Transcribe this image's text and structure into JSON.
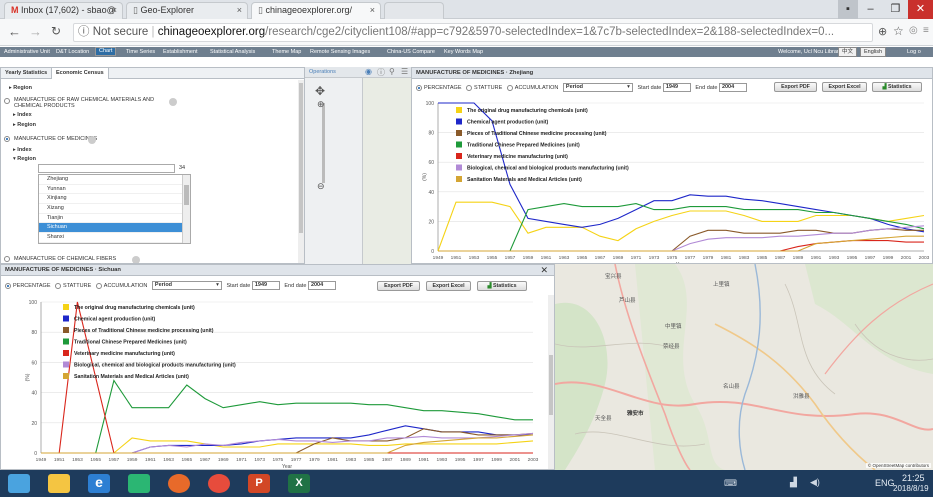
{
  "browser": {
    "tabs": [
      {
        "title": "Inbox (17,602) - sbao@",
        "icon": "gmail-icon"
      },
      {
        "title": "Geo-Explorer",
        "icon": "page-icon"
      },
      {
        "title": "chinageoexplorer.org/",
        "icon": "page-icon"
      }
    ],
    "security": "Not secure",
    "url_host": "chinageoexplorer.org",
    "url_path": "/research/cge2/cityclient108/#app=c792&5970-selectedIndex=1&7c7b-selectedIndex=2&188-selectedIndex=0..."
  },
  "appnav": {
    "items": [
      "Administrative Unit",
      "D&T Location",
      "Chart",
      "Time Series",
      "Establishment",
      "Statistical Analysis",
      "Theme Map",
      "Remote Sensing Images",
      "China-US Compare",
      "Key Words Map"
    ],
    "selected": "Chart",
    "welcome": "Welcome, Ucl Ncu Library",
    "lang_cn": "中文",
    "lang_en": "English",
    "logout": "Log o"
  },
  "left": {
    "tabs": [
      "Yearly Statistics",
      "Economic Census"
    ],
    "region_top": "▸ Region",
    "raw_chem": "MANUFACTURE OF RAW CHEMICAL MATERIALS AND CHEMICAL PRODUCTS",
    "index1": "▸ Index",
    "region1": "▸ Region",
    "medicines": "MANUFACTURE OF MEDICINES",
    "index2": "▸ Index",
    "region2": "▾ Region",
    "count": "34",
    "regions": [
      "Zhejiang",
      "Yunnan",
      "Xinjiang",
      "Xizang",
      "Tianjin",
      "Sichuan",
      "Shanxi"
    ],
    "selected_region": "Sichuan",
    "fibers": "MANUFACTURE OF CHEMICAL FIBERS"
  },
  "toolbar": {
    "operations": "Operations"
  },
  "common": {
    "percentage": "PERCENTAGE",
    "statture": "STATTURE",
    "accumulation": "ACCUMULATION",
    "period": "Period",
    "start_label": "Start date",
    "start": "1949",
    "end_label": "End date",
    "end": "2004",
    "export_pdf": "Export PDF",
    "export_excel": "Export Excel",
    "statistics": "Statistics",
    "xlabel": "Year",
    "ylabel": "(%)",
    "xticks": [
      "1949",
      "1951",
      "1953",
      "1955",
      "1957",
      "1959",
      "1961",
      "1963",
      "1965",
      "1967",
      "1969",
      "1971",
      "1973",
      "1975",
      "1977",
      "1979",
      "1981",
      "1983",
      "1985",
      "1987",
      "1989",
      "1991",
      "1993",
      "1995",
      "1997",
      "1999",
      "2001",
      "2003"
    ],
    "yticks": [
      "0",
      "20",
      "40",
      "60",
      "80",
      "100"
    ]
  },
  "top_chart_title": "MANUFACTURE OF MEDICINES · Zhejiang",
  "bottom_chart_title": "MANUFACTURE OF MEDICINES · Sichuan",
  "map": {
    "labels": [
      "上里镇",
      "芦山县",
      "荥经县",
      "中里镇",
      "雅安市",
      "名山县",
      "天全县",
      "宝兴县",
      "洪雅县"
    ],
    "attribution": "© OpenStreetMap contributors"
  },
  "taskbar": {
    "lang": "ENG",
    "time": "21:25",
    "date": "2018/8/19"
  },
  "chart_data": [
    {
      "type": "line",
      "title": "MANUFACTURE OF MEDICINES · Zhejiang",
      "xlabel": "Year",
      "ylabel": "(%)",
      "ylim": [
        0,
        100
      ],
      "x": [
        1949,
        1951,
        1953,
        1955,
        1957,
        1959,
        1961,
        1963,
        1965,
        1967,
        1969,
        1971,
        1973,
        1975,
        1977,
        1979,
        1981,
        1983,
        1985,
        1987,
        1989,
        1991,
        1993,
        1995,
        1997,
        1999,
        2001,
        2003
      ],
      "series": [
        {
          "name": "The original drug manufacturing chemicals (unit)",
          "color": "#f5d316",
          "values": [
            0,
            33,
            33,
            33,
            30,
            12,
            16,
            16,
            16,
            10,
            7,
            15,
            20,
            24,
            27,
            27,
            27,
            24,
            20,
            20,
            20,
            24,
            24,
            24,
            22,
            20,
            22,
            24
          ]
        },
        {
          "name": "Chemical agent production (unit)",
          "color": "#1e27c9",
          "values": [
            100,
            100,
            100,
            88,
            45,
            22,
            20,
            18,
            16,
            18,
            22,
            28,
            34,
            34,
            38,
            37,
            37,
            35,
            34,
            32,
            30,
            28,
            26,
            24,
            22,
            18,
            15,
            13
          ]
        },
        {
          "name": "Pieces of Traditional Chinese medicine processing (unit)",
          "color": "#8a5a2a",
          "values": [
            0,
            0,
            0,
            0,
            0,
            0,
            0,
            0,
            0,
            0,
            0,
            0,
            0,
            0,
            10,
            14,
            14,
            12,
            12,
            12,
            14,
            14,
            12,
            12,
            14,
            15,
            14,
            14
          ]
        },
        {
          "name": "Traditional Chinese Prepared Medicines (unit)",
          "color": "#1e9a3a",
          "values": [
            0,
            0,
            0,
            0,
            0,
            28,
            30,
            32,
            30,
            30,
            30,
            32,
            28,
            28,
            30,
            30,
            30,
            28,
            28,
            28,
            28,
            26,
            26,
            24,
            22,
            20,
            18,
            15
          ]
        },
        {
          "name": "Veterinary medicine manufacturing (unit)",
          "color": "#d9261c",
          "values": [
            0,
            0,
            0,
            0,
            0,
            0,
            0,
            0,
            0,
            0,
            0,
            0,
            0,
            0,
            0,
            0,
            0,
            0,
            0,
            0,
            3,
            5,
            6,
            7,
            7,
            7,
            6,
            6
          ]
        },
        {
          "name": "Biological, chemical and biological products manufacturing (unit)",
          "color": "#b18ad6",
          "values": [
            0,
            0,
            0,
            0,
            0,
            0,
            0,
            0,
            0,
            0,
            0,
            0,
            0,
            0,
            5,
            8,
            9,
            9,
            9,
            10,
            10,
            11,
            12,
            12,
            14,
            15,
            16,
            17
          ]
        },
        {
          "name": "Sanitation Materials and Medical Articles (unit)",
          "color": "#d4a534",
          "values": [
            0,
            0,
            0,
            0,
            0,
            0,
            0,
            0,
            0,
            0,
            0,
            0,
            0,
            0,
            0,
            0,
            0,
            0,
            0,
            0,
            0,
            5,
            6,
            7,
            8,
            9,
            10,
            10
          ]
        }
      ]
    },
    {
      "type": "line",
      "title": "MANUFACTURE OF MEDICINES · Sichuan",
      "xlabel": "Year",
      "ylabel": "(%)",
      "ylim": [
        0,
        100
      ],
      "x": [
        1949,
        1951,
        1953,
        1955,
        1957,
        1959,
        1961,
        1963,
        1965,
        1967,
        1969,
        1971,
        1973,
        1975,
        1977,
        1979,
        1981,
        1983,
        1985,
        1987,
        1989,
        1991,
        1993,
        1995,
        1997,
        1999,
        2001,
        2003
      ],
      "series": [
        {
          "name": "The original drug manufacturing chemicals (unit)",
          "color": "#f5d316",
          "values": [
            0,
            0,
            0,
            0,
            0,
            10,
            8,
            8,
            8,
            6,
            4,
            4,
            4,
            6,
            6,
            6,
            6,
            6,
            5,
            5,
            6,
            6,
            6,
            6,
            6,
            6,
            7,
            8
          ]
        },
        {
          "name": "Chemical agent production (unit)",
          "color": "#1e27c9",
          "values": [
            0,
            0,
            0,
            0,
            0,
            0,
            4,
            5,
            5,
            5,
            5,
            6,
            8,
            9,
            10,
            10,
            10,
            10,
            12,
            15,
            18,
            16,
            14,
            14,
            14,
            12,
            12,
            12
          ]
        },
        {
          "name": "Pieces of Traditional Chinese medicine processing (unit)",
          "color": "#8a5a2a",
          "values": [
            0,
            0,
            0,
            0,
            0,
            0,
            0,
            0,
            0,
            0,
            0,
            0,
            0,
            0,
            0,
            6,
            10,
            8,
            8,
            8,
            10,
            16,
            14,
            14,
            12,
            12,
            12,
            13
          ]
        },
        {
          "name": "Traditional Chinese Prepared Medicines (unit)",
          "color": "#1e9a3a",
          "values": [
            0,
            0,
            0,
            0,
            48,
            30,
            30,
            30,
            45,
            36,
            30,
            32,
            34,
            32,
            33,
            33,
            33,
            33,
            32,
            32,
            30,
            28,
            28,
            27,
            26,
            24,
            22,
            22
          ]
        },
        {
          "name": "Veterinary medicine manufacturing (unit)",
          "color": "#d9261c",
          "values": [
            0,
            0,
            100,
            50,
            0,
            0,
            0,
            0,
            0,
            0,
            0,
            0,
            0,
            0,
            0,
            0,
            0,
            0,
            0,
            0,
            0,
            0,
            0,
            0,
            0,
            0,
            0,
            0
          ]
        },
        {
          "name": "Biological, chemical and biological products manufacturing (unit)",
          "color": "#b18ad6",
          "values": [
            0,
            0,
            0,
            0,
            0,
            0,
            4,
            5,
            4,
            6,
            5,
            7,
            8,
            9,
            8,
            8,
            7,
            8,
            8,
            10,
            10,
            11,
            10,
            10,
            10,
            11,
            12,
            13
          ]
        },
        {
          "name": "Sanitation Materials and Medical Articles (unit)",
          "color": "#d4a534",
          "values": [
            0,
            0,
            0,
            0,
            0,
            0,
            0,
            0,
            0,
            0,
            0,
            0,
            0,
            0,
            0,
            0,
            0,
            0,
            0,
            0,
            5,
            7,
            8,
            9,
            10,
            10,
            11,
            12
          ]
        }
      ]
    }
  ]
}
